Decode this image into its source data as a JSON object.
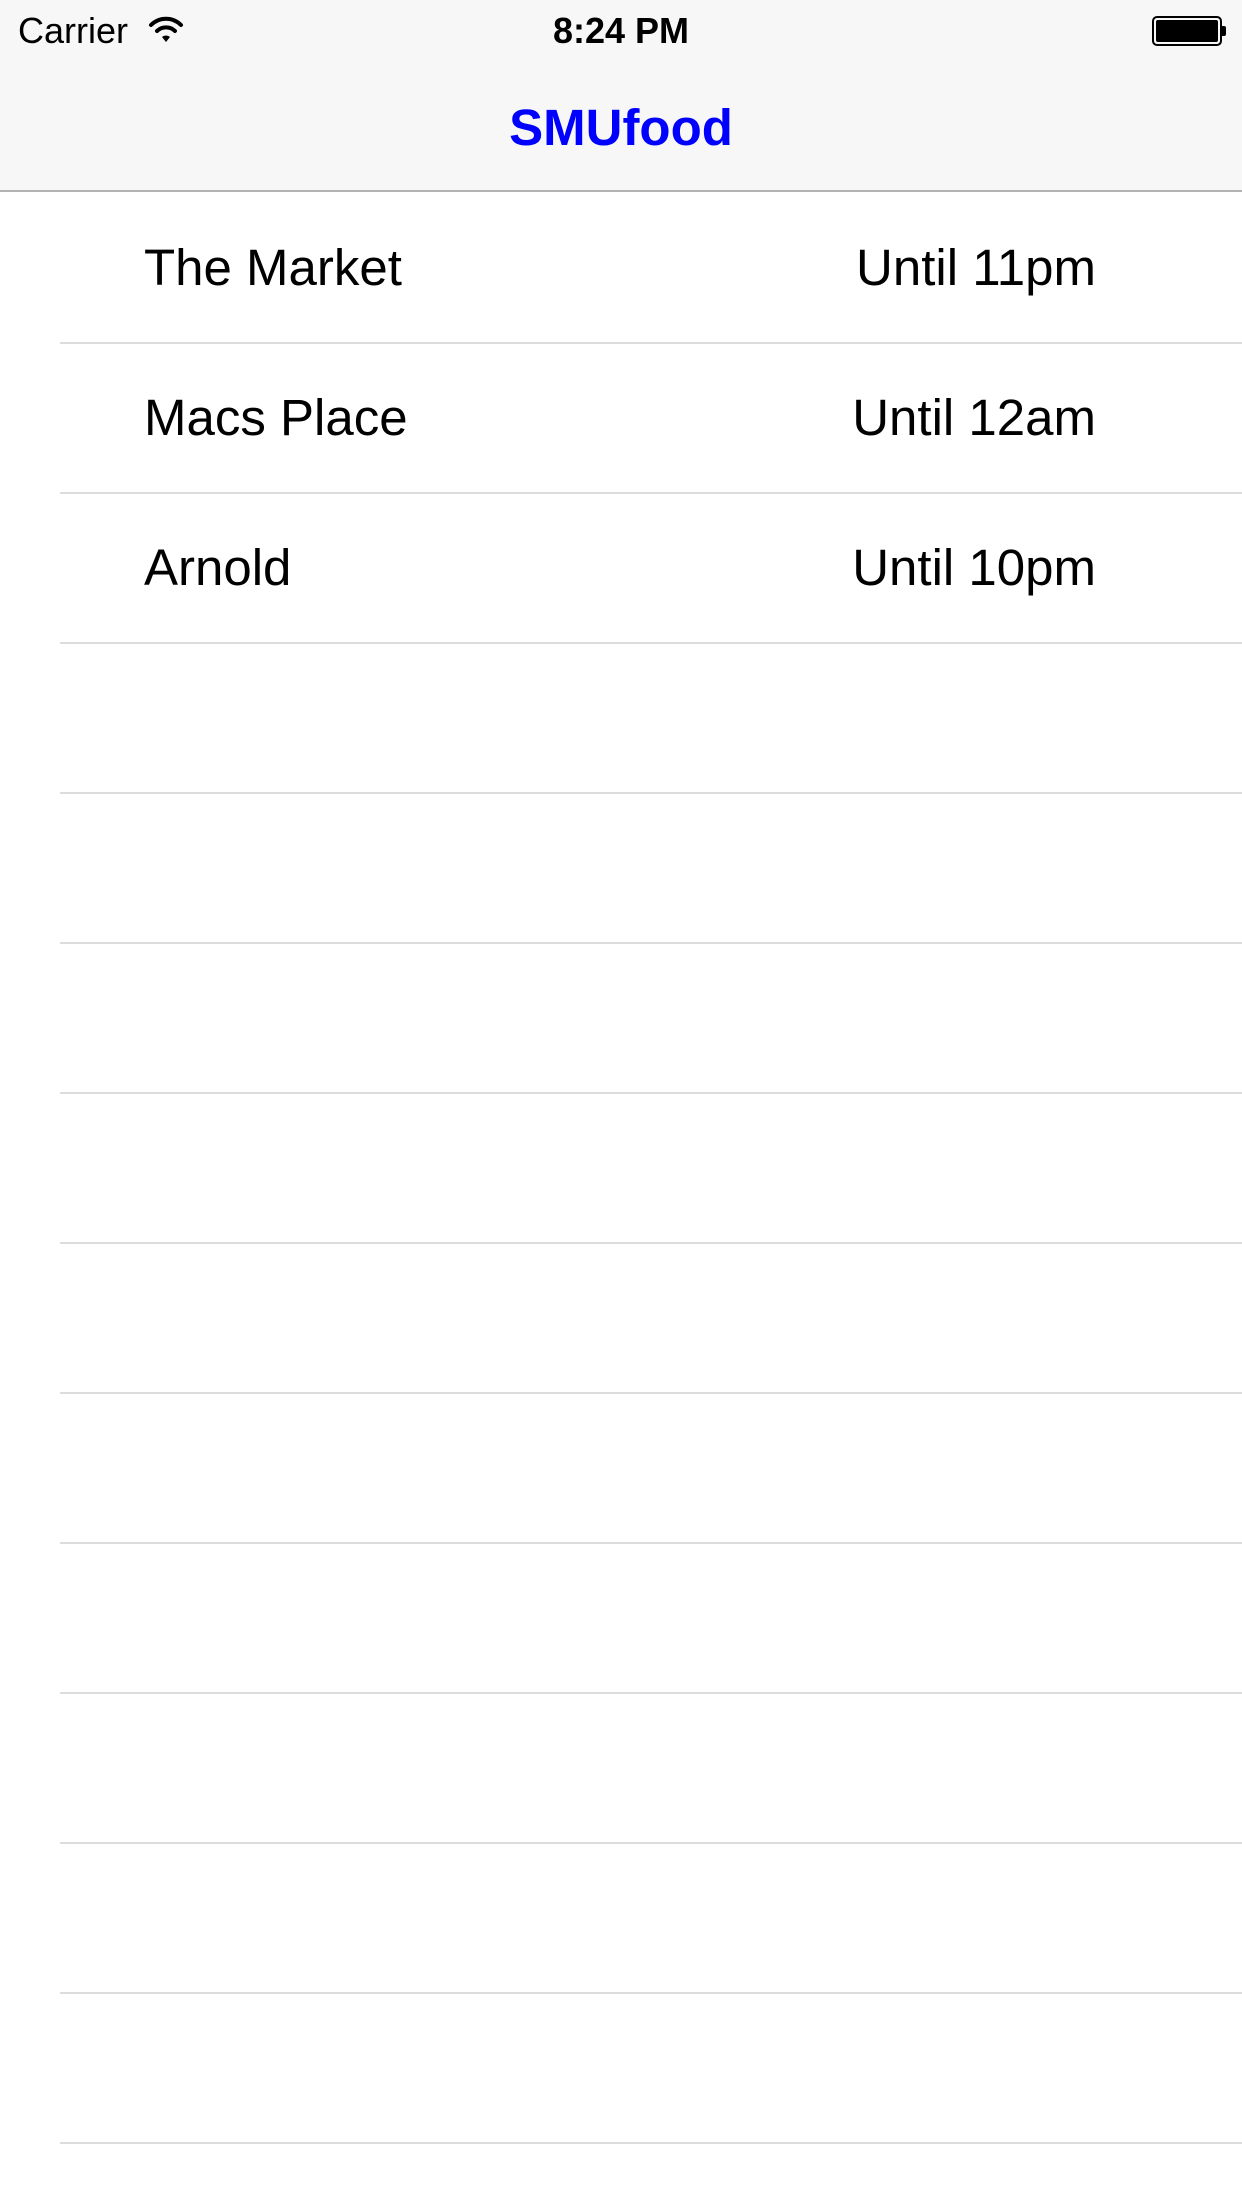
{
  "status_bar": {
    "carrier": "Carrier",
    "time": "8:24 PM",
    "icons": [
      "wifi-icon",
      "battery-icon"
    ]
  },
  "nav": {
    "title": "SMUfood",
    "title_color": "#0000ff"
  },
  "places": [
    {
      "name": "The Market",
      "hours": "Until 11pm"
    },
    {
      "name": "Macs Place",
      "hours": "Until 12am"
    },
    {
      "name": "Arnold",
      "hours": "Until 10pm"
    }
  ],
  "empty_row_count": 10,
  "colors": {
    "separator": "#dcdcdc",
    "bar_background": "#f7f7f7"
  }
}
